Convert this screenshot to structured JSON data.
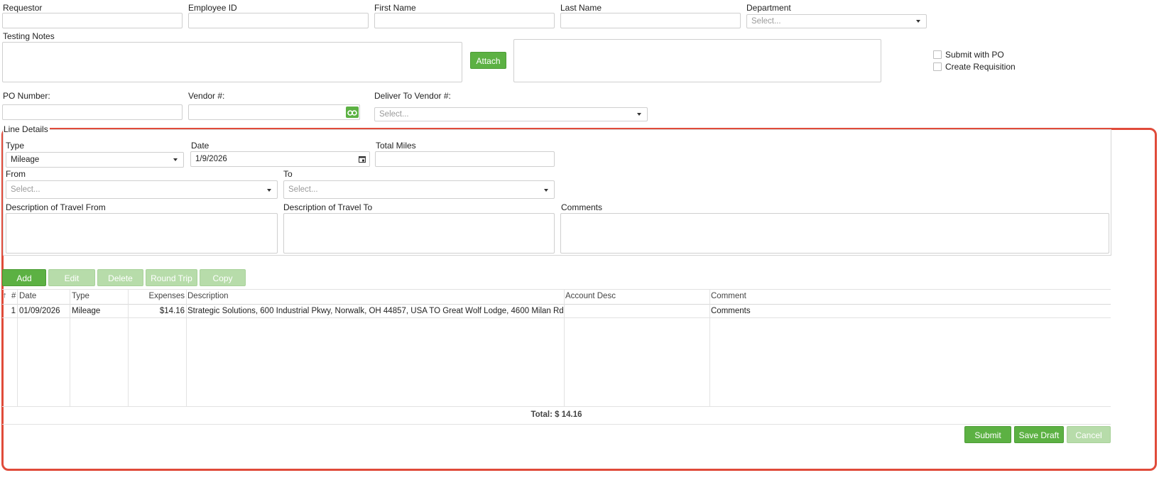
{
  "header": {
    "requestor": {
      "label": "Requestor",
      "value": ""
    },
    "employee_id": {
      "label": "Employee ID",
      "value": ""
    },
    "first_name": {
      "label": "First Name",
      "value": ""
    },
    "last_name": {
      "label": "Last Name",
      "value": ""
    },
    "department": {
      "label": "Department",
      "placeholder": "Select..."
    },
    "testing_notes": {
      "label": "Testing Notes"
    },
    "attach_label": "Attach",
    "submit_with_po": "Submit with PO",
    "create_requisition": "Create Requisition",
    "po_number": {
      "label": "PO Number:"
    },
    "vendor_number": {
      "label": "Vendor #:"
    },
    "deliver_to_vendor": {
      "label": "Deliver To Vendor #:",
      "placeholder": "Select..."
    }
  },
  "line_details": {
    "legend": "Line Details",
    "type": {
      "label": "Type",
      "value": "Mileage"
    },
    "date": {
      "label": "Date",
      "value": "1/9/2026"
    },
    "total_miles": {
      "label": "Total Miles",
      "value": ""
    },
    "from": {
      "label": "From",
      "placeholder": "Select..."
    },
    "to": {
      "label": "To",
      "placeholder": "Select..."
    },
    "desc_from": {
      "label": "Description of Travel From"
    },
    "desc_to": {
      "label": "Description of Travel To"
    },
    "comments": {
      "label": "Comments"
    }
  },
  "toolbar": {
    "add": "Add",
    "edit": "Edit",
    "delete": "Delete",
    "round_trip": "Round Trip",
    "copy": "Copy"
  },
  "grid": {
    "sort_icon": "↑",
    "columns": [
      "#",
      "Date",
      "Type",
      "Expenses",
      "Description",
      "Account Desc",
      "Comment"
    ],
    "rows": [
      {
        "num": "1",
        "date": "01/09/2026",
        "type": "Mileage",
        "expenses": "$14.16",
        "description": "Strategic Solutions, 600 Industrial Pkwy, Norwalk, OH 44857, USA TO Great Wolf Lodge, 4600 Milan Rd,...",
        "account_desc": "",
        "comment": "Comments"
      }
    ],
    "total": "Total: $ 14.16"
  },
  "footer": {
    "submit": "Submit",
    "save_draft": "Save Draft",
    "cancel": "Cancel"
  },
  "colors": {
    "accent_green": "#5cb143",
    "disabled_green": "#b7dcaa",
    "highlight_frame": "#e04b3a"
  }
}
